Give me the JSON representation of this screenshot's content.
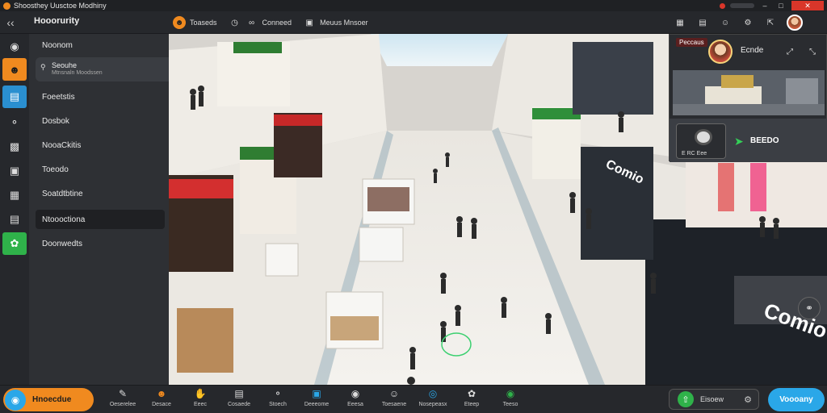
{
  "window": {
    "title": "Shoosthey Uusctoe Modhiny",
    "close_label": "✕"
  },
  "toolbar": {
    "app_name": "Hooorurity",
    "items": [
      {
        "label": "Toaseds",
        "icon": "face-icon"
      },
      {
        "label": "Conneed",
        "icon": "link-icon"
      },
      {
        "label": "Meuus Mnsoer",
        "icon": "display-icon"
      }
    ]
  },
  "sidebar": {
    "sub_title": "Seouhe",
    "sub_caption": "Mtnsnaln Moodssen",
    "items": [
      {
        "label": "Noonom"
      },
      {
        "label": "Foeetstis"
      },
      {
        "label": "Dosbok"
      },
      {
        "label": "NooaCkitis"
      },
      {
        "label": "Toeodo"
      },
      {
        "label": "Soatdtbtine"
      },
      {
        "label": "Ntoooctiona"
      },
      {
        "label": "Doonwedts"
      }
    ],
    "selected_index": 6
  },
  "pip": {
    "badge": "Peccaus",
    "name": "Ecnde",
    "camera_caption": "E RC Eee",
    "action": "BEEDO"
  },
  "bottom": {
    "start_label": "Hnoecdue",
    "tools": [
      {
        "label": "Oeserelee"
      },
      {
        "label": "Desace"
      },
      {
        "label": "Eeec"
      },
      {
        "label": "Cosaede"
      },
      {
        "label": "Stoech"
      },
      {
        "label": "Deeeome"
      },
      {
        "label": "Eeesa"
      },
      {
        "label": "Toesaene"
      },
      {
        "label": "Nosepeasx"
      },
      {
        "label": "Eteep"
      },
      {
        "label": "Teeso"
      }
    ],
    "share_label": "Eisoew",
    "cta_label": "Voooany"
  },
  "colors": {
    "accent_orange": "#f08a1f",
    "accent_blue": "#2aa7e8",
    "accent_green": "#2fb24a"
  }
}
